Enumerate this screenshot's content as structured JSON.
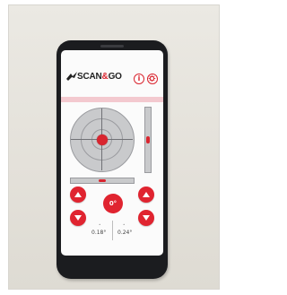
{
  "app": {
    "logo_scan": "SCAN",
    "logo_amp": "&",
    "logo_go": "GO",
    "info_glyph": "i",
    "settings_icon": "gear-icon"
  },
  "level": {
    "zero_label": "0°",
    "left_reading": "0.18°",
    "right_reading": "0.24°"
  },
  "colors": {
    "accent": "#e02430",
    "header_band": "#f3c9cf",
    "level_track": "#c9cacc"
  }
}
